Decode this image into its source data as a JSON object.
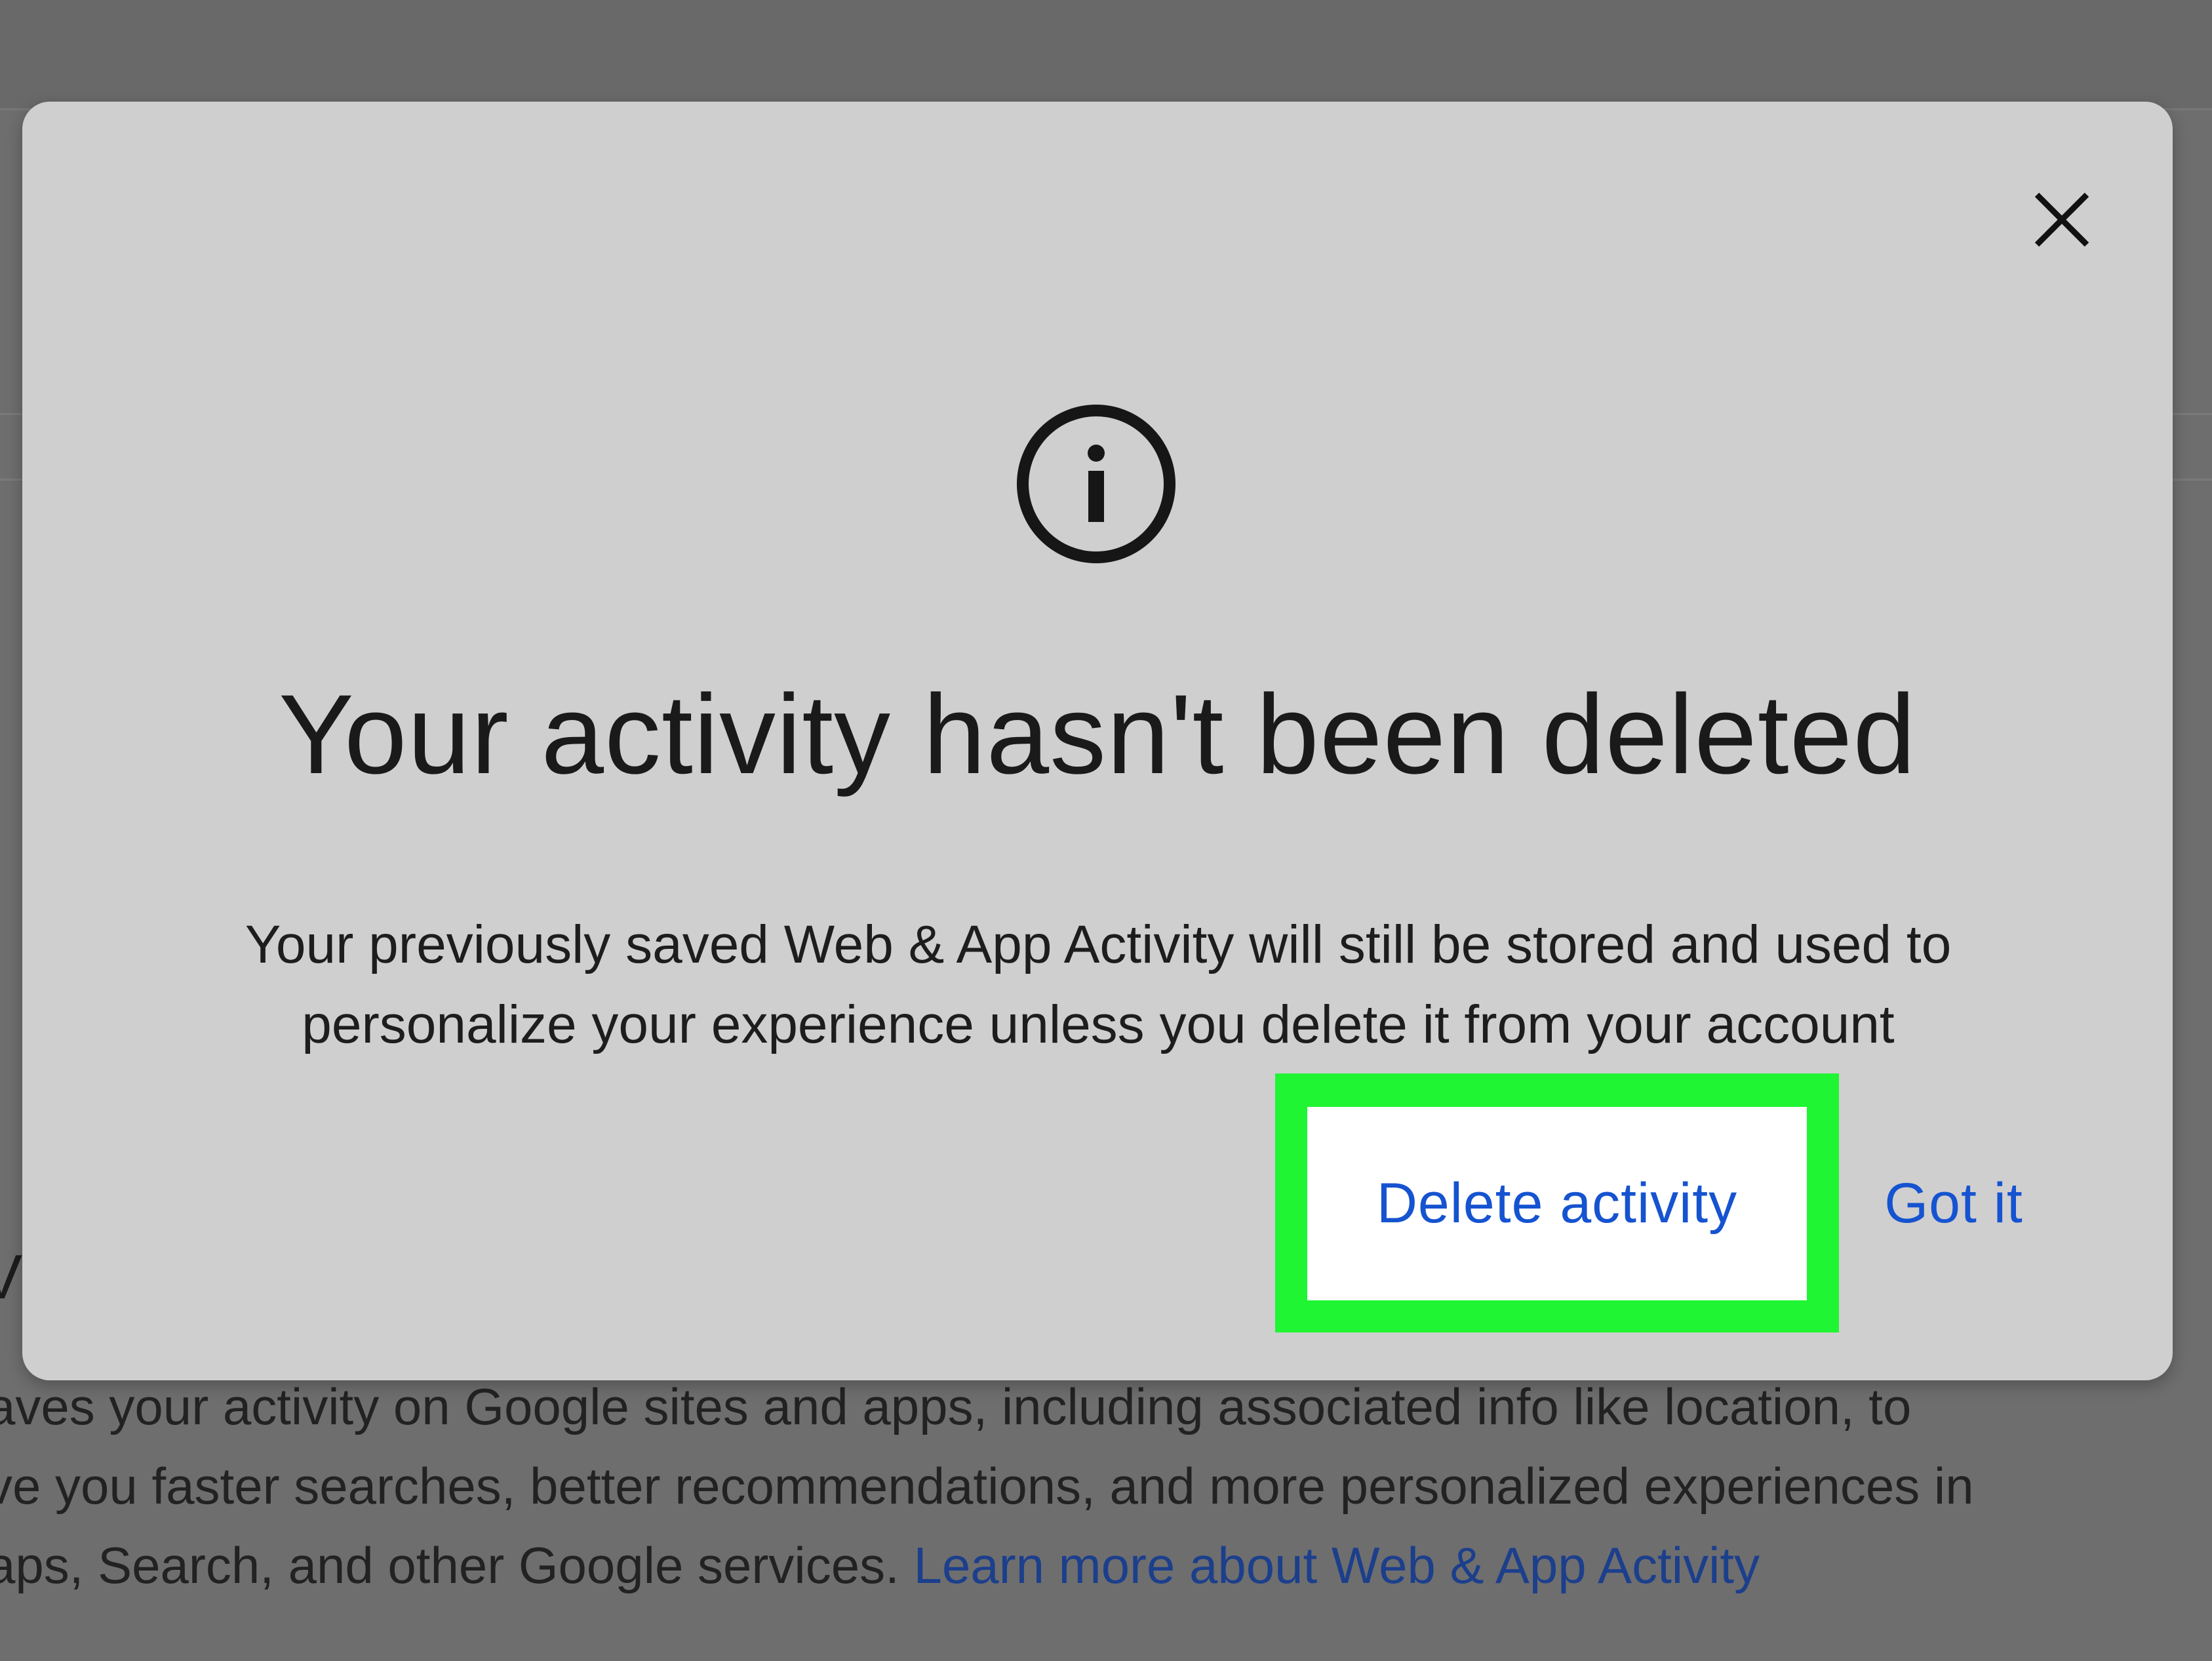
{
  "background": {
    "heading_fragment": "V",
    "description_lines": [
      "aves your activity on Google sites and apps, including associated info like location, to",
      "ve you faster searches, better recommendations, and more personalized experiences in",
      "aps, Search, and other Google services. "
    ],
    "learn_more_link": "Learn more about Web & App Activity"
  },
  "dialog": {
    "icon": "info-icon",
    "close_icon": "close-icon",
    "title": "Your activity hasn't been deleted",
    "body_lines": [
      "Your previously saved Web & App Activity will still be stored and used to",
      "personalize your experience unless you delete it from your account"
    ],
    "delete_label": "Delete activity",
    "got_it_label": "Got it"
  },
  "colors": {
    "link": "#1553d0",
    "highlight": "#1ff532",
    "dialog_bg": "#cfcfcf",
    "overlay": "#6b6b6b"
  }
}
